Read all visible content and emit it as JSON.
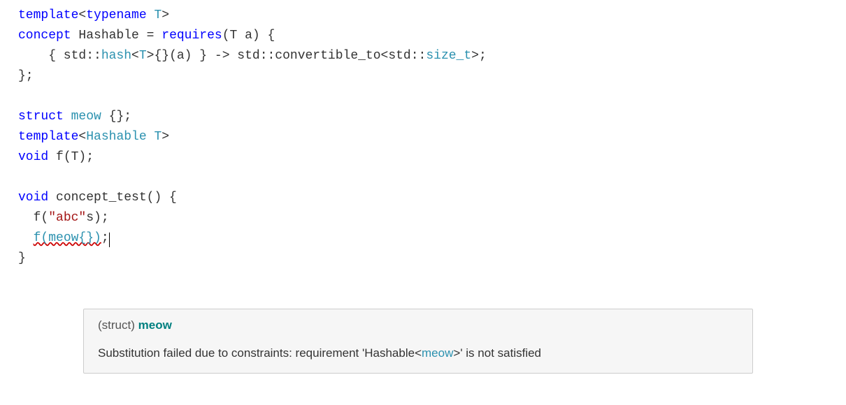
{
  "code": {
    "l1": {
      "t1": "template",
      "t2": "<",
      "t3": "typename",
      "t4": " T",
      "t5": ">"
    },
    "l2": {
      "t1": "concept",
      "t2": " Hashable ",
      "t3": "=",
      "t4": " ",
      "t5": "requires",
      "t6": "(T a) {"
    },
    "l3": {
      "t1": "    { std::",
      "t2": "hash",
      "t3": "<",
      "t4": "T",
      "t5": ">{}(a) } -> std::convertible_to<std::",
      "t6": "size_t",
      "t7": ">;"
    },
    "l4": {
      "t1": "};"
    },
    "l5": {
      "t1": ""
    },
    "l6": {
      "t1": "struct",
      "t2": " ",
      "t3": "meow",
      "t4": " {};"
    },
    "l7": {
      "t1": "template",
      "t2": "<",
      "t3": "Hashable",
      "t4": " T",
      "t5": ">"
    },
    "l8": {
      "t1": "void",
      "t2": " f(T);"
    },
    "l9": {
      "t1": ""
    },
    "l10": {
      "t1": "void",
      "t2": " concept_test() {"
    },
    "l11": {
      "t1": "  f(",
      "t2": "\"abc\"",
      "t3": "s);"
    },
    "l12": {
      "t1": "  ",
      "t2": "f(meow{})",
      "t3": ";"
    },
    "l13": {
      "t1": "}"
    }
  },
  "tooltip": {
    "kind": "(struct)",
    "name": "meow",
    "body_pre": "Substitution failed due to constraints: requirement 'Hashable",
    "angle_l": "<",
    "innerType": "meow",
    "angle_r": ">",
    "body_post": "' is not satisfied"
  }
}
